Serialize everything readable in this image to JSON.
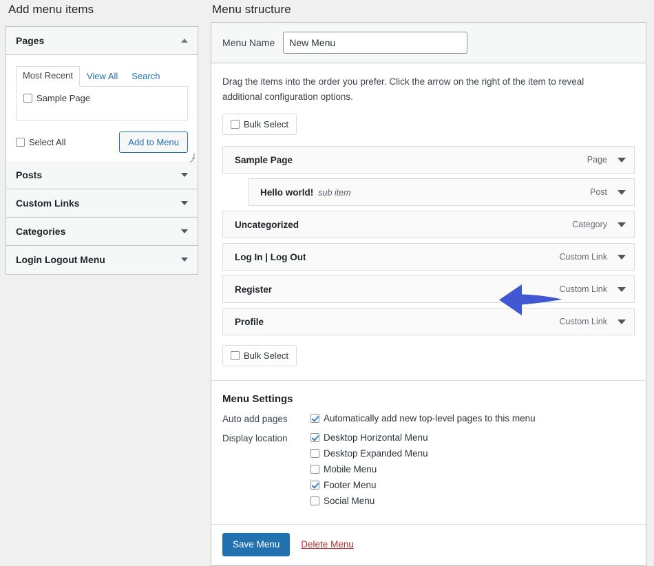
{
  "headings": {
    "add_menu_items": "Add menu items",
    "menu_structure": "Menu structure"
  },
  "sidebar": {
    "panels": [
      {
        "label": "Pages",
        "state": "open",
        "toggle_icon": "chevron-up-icon",
        "tabs": [
          {
            "label": "Most Recent",
            "active": true
          },
          {
            "label": "View All",
            "active": false
          },
          {
            "label": "Search",
            "active": false
          }
        ],
        "items": [
          {
            "label": "Sample Page",
            "checked": false
          }
        ],
        "select_all_label": "Select All",
        "select_all_checked": false,
        "add_button_label": "Add to Menu"
      },
      {
        "label": "Posts",
        "state": "closed",
        "toggle_icon": "chevron-down-icon"
      },
      {
        "label": "Custom Links",
        "state": "closed",
        "toggle_icon": "chevron-down-icon"
      },
      {
        "label": "Categories",
        "state": "closed",
        "toggle_icon": "chevron-down-icon"
      },
      {
        "label": "Login Logout Menu",
        "state": "closed",
        "toggle_icon": "chevron-down-icon"
      }
    ]
  },
  "structure": {
    "menu_name_label": "Menu Name",
    "menu_name_value": "New Menu",
    "menu_name_placeholder": "Menu Name",
    "hint": "Drag the items into the order you prefer. Click the arrow on the right of the item to reveal additional configuration options.",
    "bulk_select_top": "Bulk Select",
    "bulk_select_bottom": "Bulk Select",
    "bulk_select_checked": false,
    "items": [
      {
        "title": "Sample Page",
        "sub_label": "",
        "type": "Page",
        "depth": 0,
        "toggle_icon": "chevron-down-icon"
      },
      {
        "title": "Hello world!",
        "sub_label": "sub item",
        "type": "Post",
        "depth": 1,
        "toggle_icon": "chevron-down-icon"
      },
      {
        "title": "Uncategorized",
        "sub_label": "",
        "type": "Category",
        "depth": 0,
        "toggle_icon": "chevron-down-icon"
      },
      {
        "title": "Log In | Log Out",
        "sub_label": "",
        "type": "Custom Link",
        "depth": 0,
        "toggle_icon": "chevron-down-icon"
      },
      {
        "title": "Register",
        "sub_label": "",
        "type": "Custom Link",
        "depth": 0,
        "toggle_icon": "chevron-down-icon"
      },
      {
        "title": "Profile",
        "sub_label": "",
        "type": "Custom Link",
        "depth": 0,
        "toggle_icon": "chevron-down-icon"
      }
    ]
  },
  "settings": {
    "title": "Menu Settings",
    "auto_add_label": "Auto add pages",
    "auto_add_option": "Automatically add new top-level pages to this menu",
    "auto_add_checked": true,
    "display_location_label": "Display location",
    "locations": [
      {
        "label": "Desktop Horizontal Menu",
        "checked": true
      },
      {
        "label": "Desktop Expanded Menu",
        "checked": false
      },
      {
        "label": "Mobile Menu",
        "checked": false
      },
      {
        "label": "Footer Menu",
        "checked": true
      },
      {
        "label": "Social Menu",
        "checked": false
      }
    ]
  },
  "footer": {
    "save_label": "Save Menu",
    "delete_label": "Delete Menu"
  },
  "annotation": {
    "icon": "left-arrow-annotation",
    "color": "#4257d2",
    "points_at": "Register"
  },
  "colors": {
    "accent": "#2271b1",
    "danger": "#b32d2e",
    "page_background": "#f0f0f1",
    "annotation": "#4257d2"
  }
}
